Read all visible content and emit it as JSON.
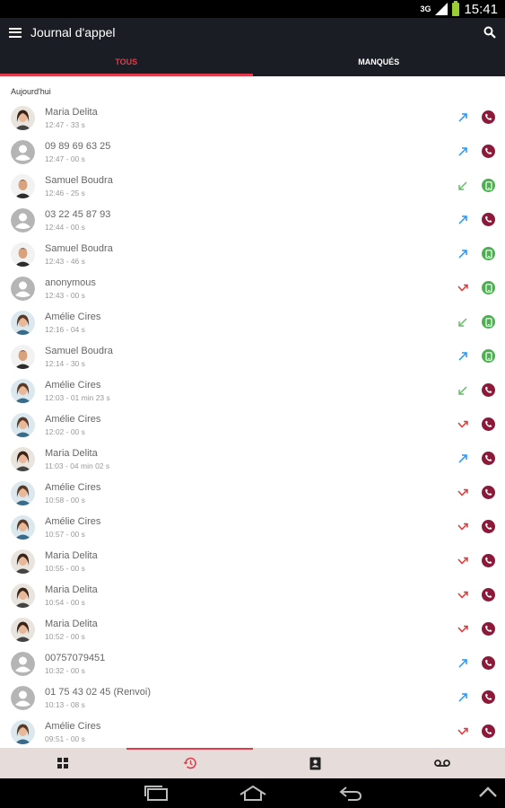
{
  "status_bar": {
    "network": "3G",
    "time": "15:41"
  },
  "app_bar": {
    "title": "Journal d'appel"
  },
  "tabs": [
    {
      "label": "TOUS",
      "active": true
    },
    {
      "label": "MANQUÉS",
      "active": false
    }
  ],
  "section": {
    "label": "Aujourd'hui"
  },
  "colors": {
    "outgoing": "#2196f3",
    "incoming": "#66bb6a",
    "missed": "#e53935",
    "voip": "#8b1a3a",
    "mobile": "#4caf50",
    "accent": "#e23c4c"
  },
  "calls": [
    {
      "name": "Maria Delita",
      "meta": "12:47 - 33 s",
      "avatar": "maria",
      "direction": "outgoing",
      "type": "voip"
    },
    {
      "name": "09 89 69 63 25",
      "meta": "12:47 - 00 s",
      "avatar": "default",
      "direction": "outgoing",
      "type": "voip"
    },
    {
      "name": "Samuel Boudra",
      "meta": "12:46 - 25 s",
      "avatar": "samuel",
      "direction": "incoming",
      "type": "mobile"
    },
    {
      "name": "03 22 45 87 93",
      "meta": "12:44 - 00 s",
      "avatar": "default",
      "direction": "outgoing",
      "type": "voip"
    },
    {
      "name": "Samuel Boudra",
      "meta": "12:43 - 46 s",
      "avatar": "samuel",
      "direction": "outgoing",
      "type": "mobile"
    },
    {
      "name": "anonymous",
      "meta": "12:43 - 00 s",
      "avatar": "default",
      "direction": "missed",
      "type": "mobile"
    },
    {
      "name": "Amélie Cires",
      "meta": "12:16 - 04 s",
      "avatar": "amelie",
      "direction": "incoming",
      "type": "mobile"
    },
    {
      "name": "Samuel Boudra",
      "meta": "12:14 - 30 s",
      "avatar": "samuel",
      "direction": "outgoing",
      "type": "mobile"
    },
    {
      "name": "Amélie Cires",
      "meta": "12:03 - 01 min 23 s",
      "avatar": "amelie",
      "direction": "incoming",
      "type": "voip"
    },
    {
      "name": "Amélie Cires",
      "meta": "12:02 - 00 s",
      "avatar": "amelie",
      "direction": "missed",
      "type": "voip"
    },
    {
      "name": "Maria Delita",
      "meta": "11:03 - 04 min 02 s",
      "avatar": "maria",
      "direction": "outgoing",
      "type": "voip"
    },
    {
      "name": "Amélie Cires",
      "meta": "10:58 - 00 s",
      "avatar": "amelie",
      "direction": "missed",
      "type": "voip"
    },
    {
      "name": "Amélie Cires",
      "meta": "10:57 - 00 s",
      "avatar": "amelie",
      "direction": "missed",
      "type": "voip"
    },
    {
      "name": "Maria Delita",
      "meta": "10:55 - 00 s",
      "avatar": "maria",
      "direction": "missed",
      "type": "voip"
    },
    {
      "name": "Maria Delita",
      "meta": "10:54 - 00 s",
      "avatar": "maria",
      "direction": "missed",
      "type": "voip"
    },
    {
      "name": "Maria Delita",
      "meta": "10:52 - 00 s",
      "avatar": "maria",
      "direction": "missed",
      "type": "voip"
    },
    {
      "name": "00757079451",
      "meta": "10:32 - 00 s",
      "avatar": "default",
      "direction": "outgoing",
      "type": "voip"
    },
    {
      "name": "01 75 43 02 45 (Renvoi)",
      "meta": "10:13 - 08 s",
      "avatar": "default",
      "direction": "outgoing",
      "type": "voip"
    },
    {
      "name": "Amélie Cires",
      "meta": "09:51 - 00 s",
      "avatar": "amelie",
      "direction": "missed",
      "type": "voip"
    }
  ],
  "bottom_nav": [
    {
      "icon": "dialpad-grid-icon",
      "active": false
    },
    {
      "icon": "history-icon",
      "active": true
    },
    {
      "icon": "contacts-icon",
      "active": false
    },
    {
      "icon": "voicemail-icon",
      "active": false
    }
  ]
}
